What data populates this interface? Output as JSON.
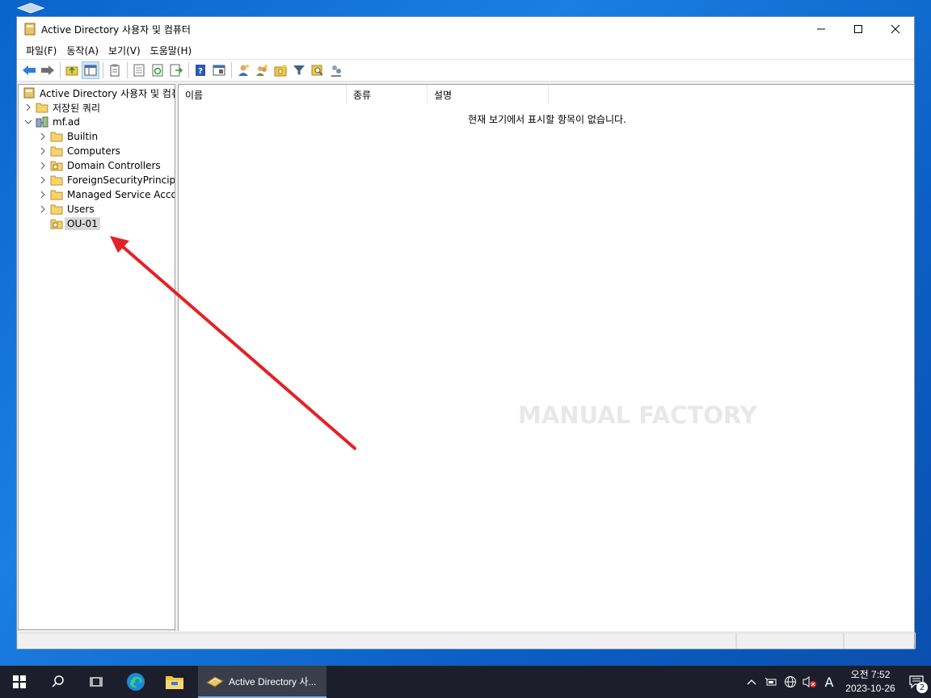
{
  "window": {
    "title": "Active Directory 사용자 및 컴퓨터",
    "menu": [
      "파일(F)",
      "동작(A)",
      "보기(V)",
      "도움말(H)"
    ]
  },
  "toolbar": {
    "icons": [
      "back-arrow-icon",
      "forward-arrow-icon",
      "up-folder-icon",
      "show-tree-icon",
      "clipboard-icon",
      "properties-icon",
      "refresh-icon",
      "export-list-icon",
      "help-icon",
      "detail-view-icon",
      "new-user-icon",
      "new-group-icon",
      "new-ou-icon",
      "filter-icon",
      "find-icon",
      "delegate-icon"
    ]
  },
  "tree": {
    "root": "Active Directory 사용자 및 컴퓨",
    "items": [
      {
        "label": "저장된 쿼리"
      },
      {
        "label": "mf.ad"
      },
      {
        "label": "Builtin"
      },
      {
        "label": "Computers"
      },
      {
        "label": "Domain Controllers"
      },
      {
        "label": "ForeignSecurityPrincipals"
      },
      {
        "label": "Managed Service Accou"
      },
      {
        "label": "Users"
      },
      {
        "label": "OU-01"
      }
    ]
  },
  "list": {
    "columns": [
      "이름",
      "종류",
      "설명"
    ],
    "empty_message": "현재 보기에서 표시할 항목이 없습니다."
  },
  "watermark": "MANUAL FACTORY",
  "annotation": {
    "color": "#e32227"
  },
  "taskbar": {
    "app_label": "Active Directory 사...",
    "ime": "A",
    "clock_time": "오전 7:52",
    "clock_date": "2023-10-26",
    "notification_count": "2"
  }
}
